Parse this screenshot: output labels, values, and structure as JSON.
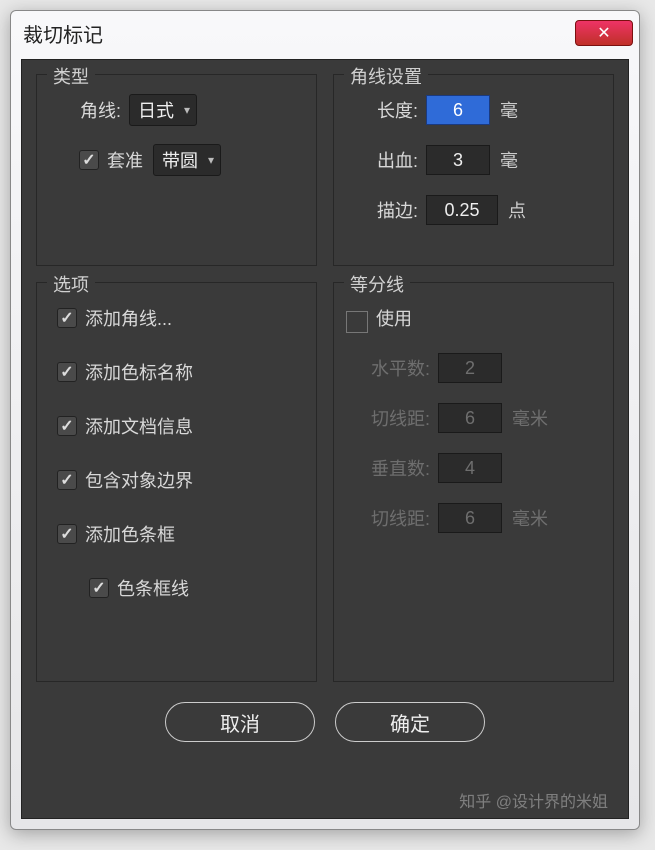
{
  "window": {
    "title": "裁切标记"
  },
  "type_group": {
    "legend": "类型",
    "corner_label": "角线:",
    "corner_value": "日式",
    "registration_label": "套准",
    "registration_checked": true,
    "registration_value": "带圆"
  },
  "corner_group": {
    "legend": "角线设置",
    "length_label": "长度:",
    "length_value": "6",
    "length_unit": "毫",
    "bleed_label": "出血:",
    "bleed_value": "3",
    "bleed_unit": "毫",
    "stroke_label": "描边:",
    "stroke_value": "0.25",
    "stroke_unit": "点"
  },
  "options_group": {
    "legend": "选项",
    "items": [
      {
        "label": "添加角线...",
        "checked": true
      },
      {
        "label": "添加色标名称",
        "checked": true
      },
      {
        "label": "添加文档信息",
        "checked": true
      },
      {
        "label": "包含对象边界",
        "checked": true
      },
      {
        "label": "添加色条框",
        "checked": true
      },
      {
        "label": "色条框线",
        "checked": true,
        "indent": true
      }
    ]
  },
  "divider_group": {
    "legend": "等分线",
    "use_label": "使用",
    "horiz_count_label": "水平数:",
    "horiz_count": "2",
    "horiz_gap_label": "切线距:",
    "horiz_gap": "6",
    "gap_unit": "毫米",
    "vert_count_label": "垂直数:",
    "vert_count": "4",
    "vert_gap_label": "切线距:",
    "vert_gap": "6"
  },
  "buttons": {
    "cancel": "取消",
    "ok": "确定"
  },
  "watermark": "知乎 @设计界的米姐"
}
